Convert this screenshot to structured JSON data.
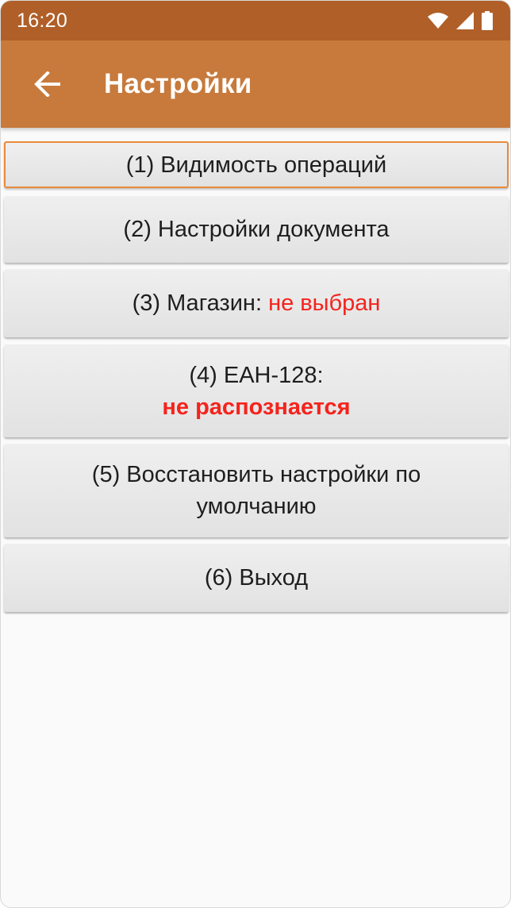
{
  "status_bar": {
    "time": "16:20",
    "icons": [
      "wifi-icon",
      "cell-signal-icon",
      "battery-icon"
    ]
  },
  "app_bar": {
    "back_icon": "arrow-left-icon",
    "title": "Настройки"
  },
  "menu": {
    "item1": {
      "label": "(1) Видимость операций"
    },
    "item2": {
      "label": "(2) Настройки документа"
    },
    "item3": {
      "label": "(3) Магазин: ",
      "value": "не выбран"
    },
    "item4": {
      "label": "(4) ЕАН-128:",
      "value": "не распознается"
    },
    "item5": {
      "line1": "(5) Восстановить настройки по",
      "line2": "умолчанию"
    },
    "item6": {
      "label": "(6) Выход"
    }
  },
  "colors": {
    "status_bar": "#b05f28",
    "app_bar": "#c77a3c",
    "focus_border": "#e98a3a",
    "warning_text": "#f5231c"
  }
}
